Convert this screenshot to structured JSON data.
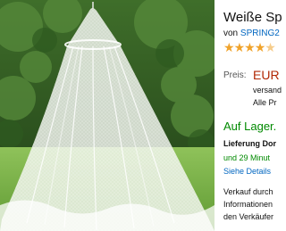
{
  "product": {
    "title": "Weiße Sp",
    "brand_prefix": "von",
    "brand": "SPRING2",
    "rating_stars": 4.5,
    "price_label": "Preis:",
    "price": "EUR",
    "shipping_text": "versand",
    "prime_text": "Alle Pr",
    "stock": "Auf Lager.",
    "delivery_label": "Lieferung Dor",
    "delivery_time": "und 29 Minut",
    "details_link": "Siehe Details",
    "seller_line1": "Verkauf durch",
    "seller_line2": "Informationen",
    "seller_line3": "den Verkäufer"
  },
  "colors": {
    "price": "#b12704",
    "in_stock": "#008a00",
    "link": "#0066c0",
    "star": "#f0a32b"
  }
}
